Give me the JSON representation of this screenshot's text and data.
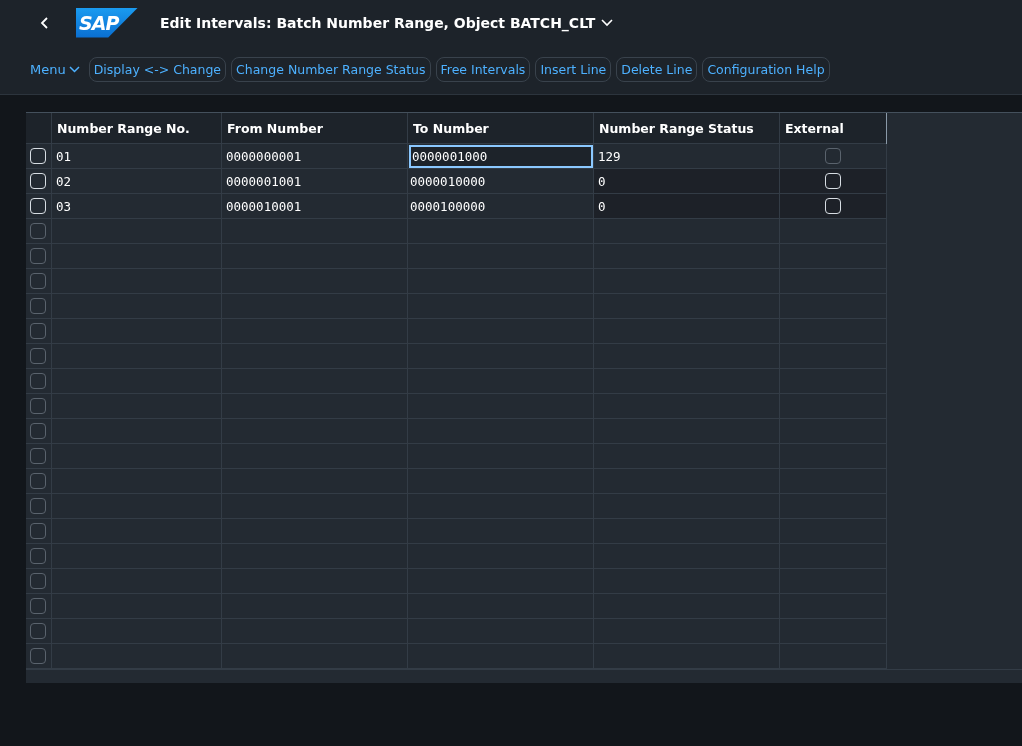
{
  "header": {
    "title": "Edit Intervals: Batch Number Range, Object BATCH_CLT",
    "logo": "SAP"
  },
  "toolbar": {
    "menu": "Menu",
    "buttons": [
      "Display <-> Change",
      "Change Number Range Status",
      "Free Intervals",
      "Insert Line",
      "Delete Line",
      "Configuration Help"
    ]
  },
  "table": {
    "columns": [
      "Number Range No.",
      "From Number",
      "To Number",
      "Number Range Status",
      "External"
    ],
    "rows": [
      {
        "selected": false,
        "number": "01",
        "from": "0000000001",
        "to": "0000001000",
        "to_focused": true,
        "status": "129",
        "external": {
          "checked": false,
          "disabled": true
        }
      },
      {
        "selected": false,
        "number": "02",
        "from": "0000001001",
        "to": "0000010000",
        "to_focused": false,
        "status": "0",
        "external": {
          "checked": false,
          "disabled": false
        }
      },
      {
        "selected": false,
        "number": "03",
        "from": "0000010001",
        "to": "0000100000",
        "to_focused": false,
        "status": "0",
        "external": {
          "checked": false,
          "disabled": false
        }
      }
    ],
    "empty_rows": [
      {
        "selected": false
      },
      {
        "selected": false
      },
      {
        "selected": false
      },
      {
        "selected": false
      },
      {
        "selected": false
      },
      {
        "selected": false
      },
      {
        "selected": false
      },
      {
        "selected": false
      },
      {
        "selected": false
      },
      {
        "selected": false
      },
      {
        "selected": false
      },
      {
        "selected": false
      },
      {
        "selected": false
      },
      {
        "selected": false
      },
      {
        "selected": false
      },
      {
        "selected": false
      },
      {
        "selected": false
      },
      {
        "selected": false
      }
    ]
  }
}
